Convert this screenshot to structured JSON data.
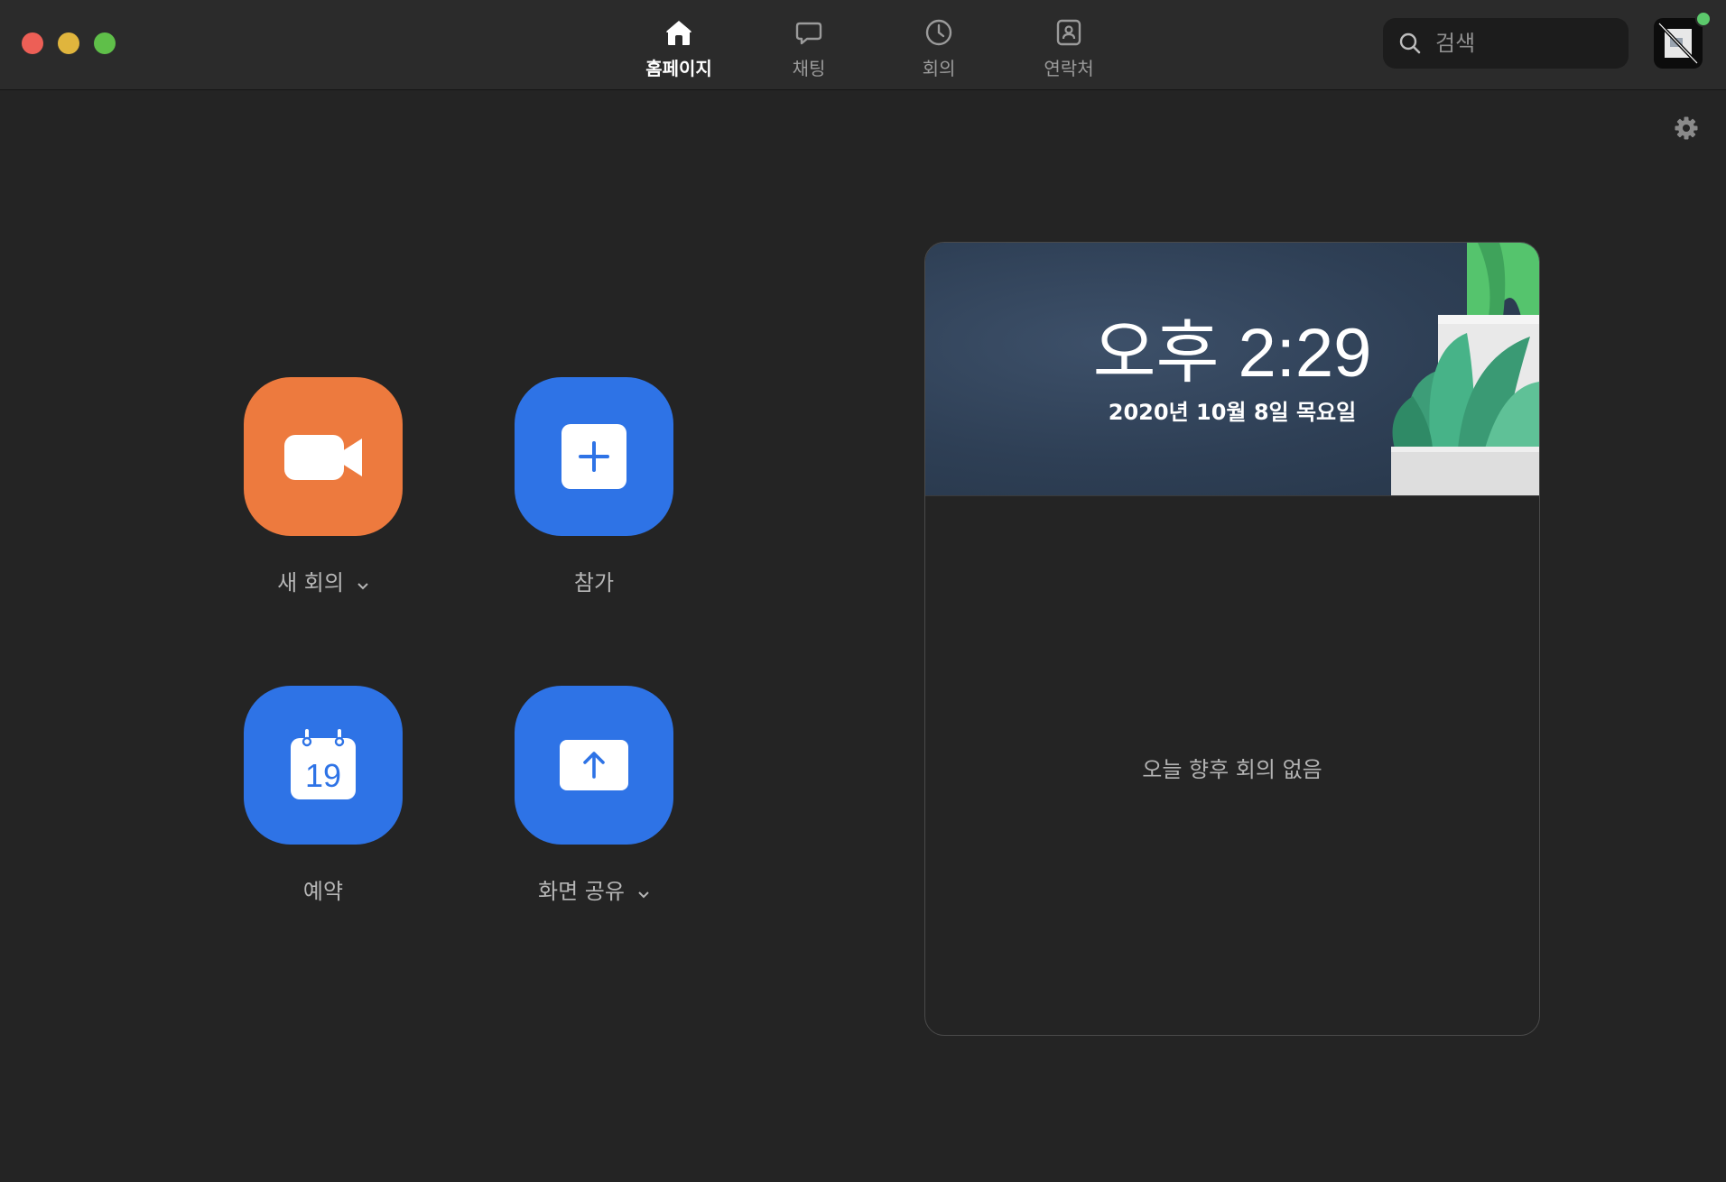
{
  "nav": {
    "tabs": [
      {
        "label": "홈페이지",
        "icon": "home-icon",
        "active": true
      },
      {
        "label": "채팅",
        "icon": "chat-icon",
        "active": false
      },
      {
        "label": "회의",
        "icon": "clock-icon",
        "active": false
      },
      {
        "label": "연락처",
        "icon": "contacts-icon",
        "active": false
      }
    ]
  },
  "search": {
    "placeholder": "검색"
  },
  "actions": {
    "new_meeting": {
      "label": "새 회의",
      "icon": "video-camera-icon",
      "color": "#ed7a3e"
    },
    "join": {
      "label": "참가",
      "icon": "plus-icon",
      "color": "#2e73e6"
    },
    "schedule": {
      "label": "예약",
      "icon": "calendar-icon",
      "calendar_day": "19",
      "color": "#2e73e6"
    },
    "share_screen": {
      "label": "화면 공유",
      "icon": "upload-arrow-icon",
      "color": "#2e73e6"
    }
  },
  "meetings_panel": {
    "time": "오후 2:29",
    "date": "2020년 10월 8일 목요일",
    "empty_message": "오늘 향후 회의 없음"
  },
  "colors": {
    "background": "#242424",
    "titlebar": "#2b2b2b",
    "accent_blue": "#2e73e6",
    "accent_orange": "#ed7a3e",
    "status_online": "#5cc96c"
  }
}
